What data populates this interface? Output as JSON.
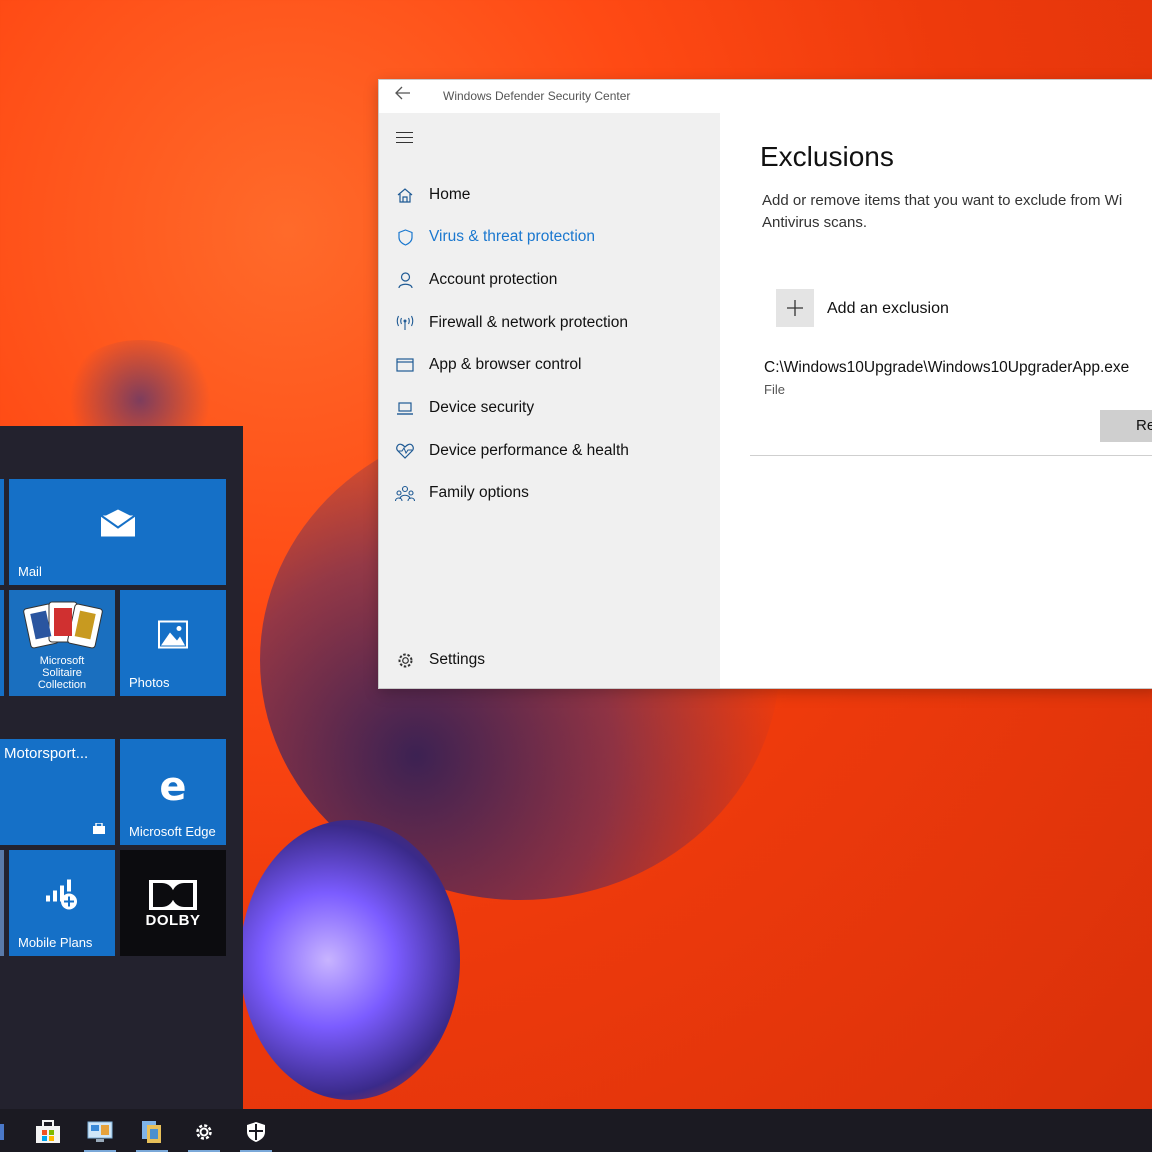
{
  "window": {
    "title": "Windows Defender Security Center",
    "back_icon": "arrow-left-icon"
  },
  "nav": {
    "items": [
      {
        "label": "Home",
        "icon": "home-icon"
      },
      {
        "label": "Virus & threat protection",
        "icon": "shield-icon",
        "selected": true
      },
      {
        "label": "Account protection",
        "icon": "person-icon"
      },
      {
        "label": "Firewall & network protection",
        "icon": "antenna-icon"
      },
      {
        "label": "App & browser control",
        "icon": "browser-window-icon"
      },
      {
        "label": "Device security",
        "icon": "laptop-icon"
      },
      {
        "label": "Device performance & health",
        "icon": "heart-icon"
      },
      {
        "label": "Family options",
        "icon": "family-icon"
      }
    ],
    "settings_label": "Settings"
  },
  "content": {
    "heading": "Exclusions",
    "description": "Add or remove items that you want to exclude from Wi Antivirus scans.",
    "add_label": "Add an exclusion",
    "exclusion": {
      "path": "C:\\Windows10Upgrade\\Windows10UpgraderApp.exe",
      "type": "File"
    },
    "remove_label": "Re"
  },
  "start": {
    "tiles": {
      "mail": "Mail",
      "solitaire": "Microsoft Solitaire Collection",
      "photos": "Photos",
      "motorsport": "Motorsport...",
      "edge": "Microsoft Edge",
      "mobile_plans": "Mobile Plans",
      "dolby": "DOLBY"
    }
  },
  "colors": {
    "accent": "#1b78cf",
    "tile": "#1570c7",
    "start_bg": "#23222e",
    "nav_bg": "#f0f0f0"
  }
}
